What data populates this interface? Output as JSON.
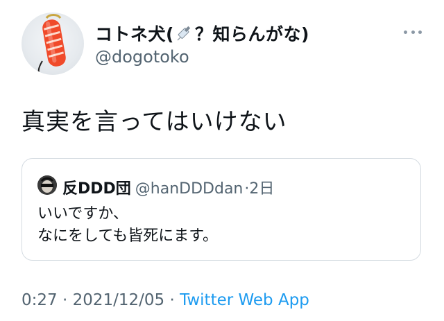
{
  "author": {
    "name_before": "コトネ犬(",
    "name_after": "？知らんがな)",
    "handle": "@dogotoko",
    "avatar_icon": "sushi-keychain-avatar",
    "name_icon": "syringe-icon"
  },
  "tweet": {
    "text": "真実を言ってはいけない"
  },
  "quote": {
    "name": "反DDD団",
    "handle": "@hanDDDdan",
    "separator": "·",
    "time": "2日",
    "lines": [
      "いいですか、",
      "なにをしても皆死にます。"
    ]
  },
  "meta": {
    "time": "0:27",
    "separator1": "·",
    "date": "2021/12/05",
    "separator2": "·",
    "source": "Twitter Web App"
  },
  "colors": {
    "text": "#0f1419",
    "secondary": "#536471",
    "link": "#1d9bf0",
    "border": "#d4dbe1"
  }
}
